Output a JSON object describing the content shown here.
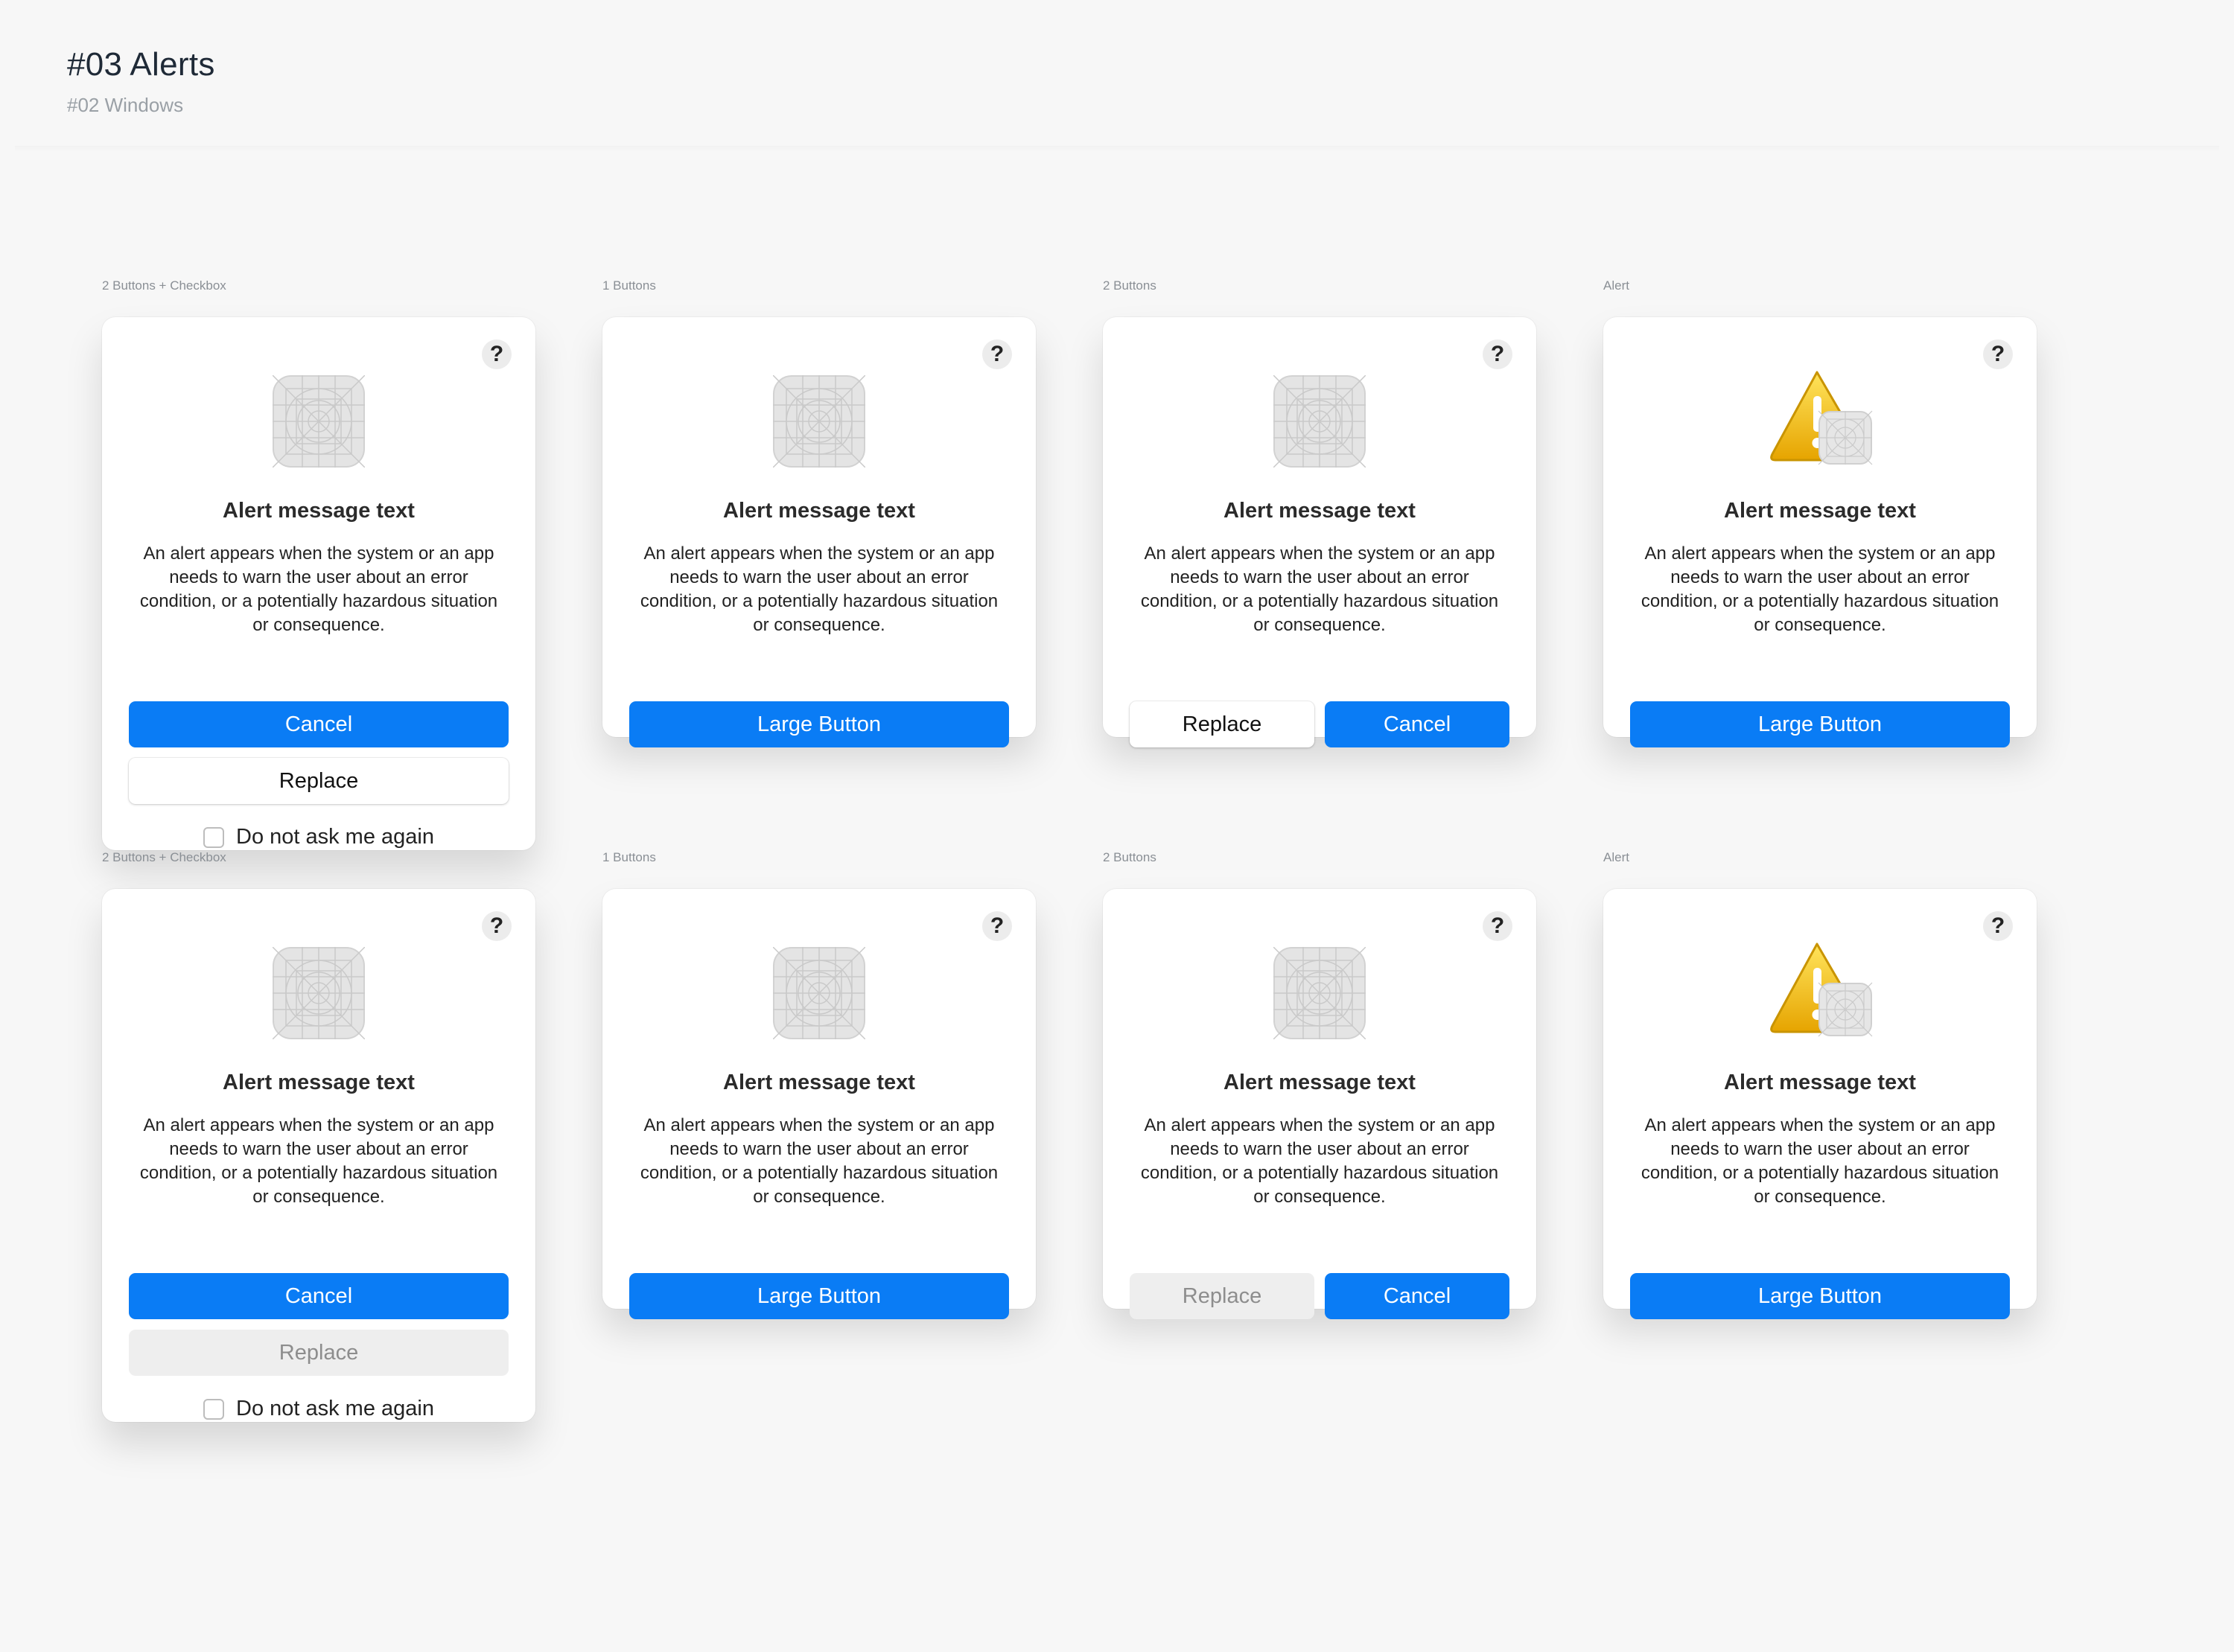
{
  "page": {
    "title": "#03 Alerts",
    "subtitle": "#02 Windows"
  },
  "colors": {
    "primary": "#0a7cf5",
    "disabled_bg": "#eeeeee",
    "disabled_text": "#8d8d8d",
    "warning": "#f5c400"
  },
  "alert": {
    "title": "Alert message text",
    "body": "An alert appears when the system or an app needs to warn the user about an error condition, or a potentially hazardous situation or consequence.",
    "help": "?"
  },
  "labels": {
    "checkbox_variant": "2 Buttons + Checkbox",
    "one_button": "1 Buttons",
    "two_buttons": "2 Buttons",
    "alert_variant": "Alert"
  },
  "buttons": {
    "cancel": "Cancel",
    "replace": "Replace",
    "large": "Large Button"
  },
  "checkbox": {
    "label": "Do not ask me again",
    "checked": false
  },
  "icons": {
    "app": "app-icon-placeholder",
    "warning": "warning-triangle-icon",
    "help": "question-mark-icon"
  }
}
